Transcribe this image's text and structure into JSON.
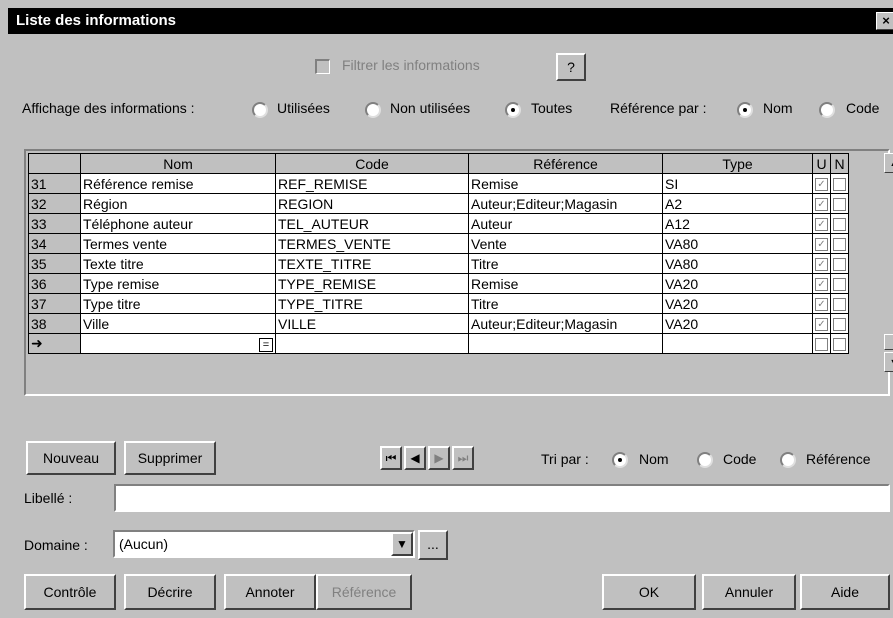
{
  "window": {
    "title": "Liste des informations",
    "close_glyph": "×"
  },
  "filter": {
    "label": "Filtrer les informations",
    "help_label": "?"
  },
  "display": {
    "label": "Affichage des informations :",
    "options": [
      "Utilisées",
      "Non utilisées",
      "Toutes"
    ],
    "selected": "Toutes"
  },
  "reference_by": {
    "label": "Référence par :",
    "options": [
      "Nom",
      "Code"
    ],
    "selected": "Nom"
  },
  "grid": {
    "columns": [
      "Nom",
      "Code",
      "Référence",
      "Type",
      "U",
      "N"
    ],
    "rows": [
      {
        "num": "31",
        "nom": "Référence remise",
        "code": "REF_REMISE",
        "ref": "Remise",
        "type": "SI"
      },
      {
        "num": "32",
        "nom": "Région",
        "code": "REGION",
        "ref": "Auteur;Editeur;Magasin",
        "type": "A2"
      },
      {
        "num": "33",
        "nom": "Téléphone auteur",
        "code": "TEL_AUTEUR",
        "ref": "Auteur",
        "type": "A12"
      },
      {
        "num": "34",
        "nom": "Termes vente",
        "code": "TERMES_VENTE",
        "ref": "Vente",
        "type": "VA80"
      },
      {
        "num": "35",
        "nom": "Texte titre",
        "code": "TEXTE_TITRE",
        "ref": "Titre",
        "type": "VA80"
      },
      {
        "num": "36",
        "nom": "Type remise",
        "code": "TYPE_REMISE",
        "ref": "Remise",
        "type": "VA20"
      },
      {
        "num": "37",
        "nom": "Type titre",
        "code": "TYPE_TITRE",
        "ref": "Titre",
        "type": "VA20"
      },
      {
        "num": "38",
        "nom": "Ville",
        "code": "VILLE",
        "ref": "Auteur;Editeur;Magasin",
        "type": "VA20"
      }
    ],
    "new_row_marker": "➜",
    "equals_glyph": "="
  },
  "buttons": {
    "nouveau": "Nouveau",
    "supprimer": "Supprimer",
    "controle": "Contrôle",
    "decrire": "Décrire",
    "annoter": "Annoter",
    "reference": "Référence",
    "ok": "OK",
    "annuler": "Annuler",
    "aide": "Aide",
    "browse": "..."
  },
  "sort": {
    "label": "Tri par :",
    "options": [
      "Nom",
      "Code",
      "Référence"
    ],
    "selected": "Nom"
  },
  "libelle": {
    "label": "Libellé :",
    "value": ""
  },
  "domaine": {
    "label": "Domaine :",
    "value": "(Aucun)"
  }
}
